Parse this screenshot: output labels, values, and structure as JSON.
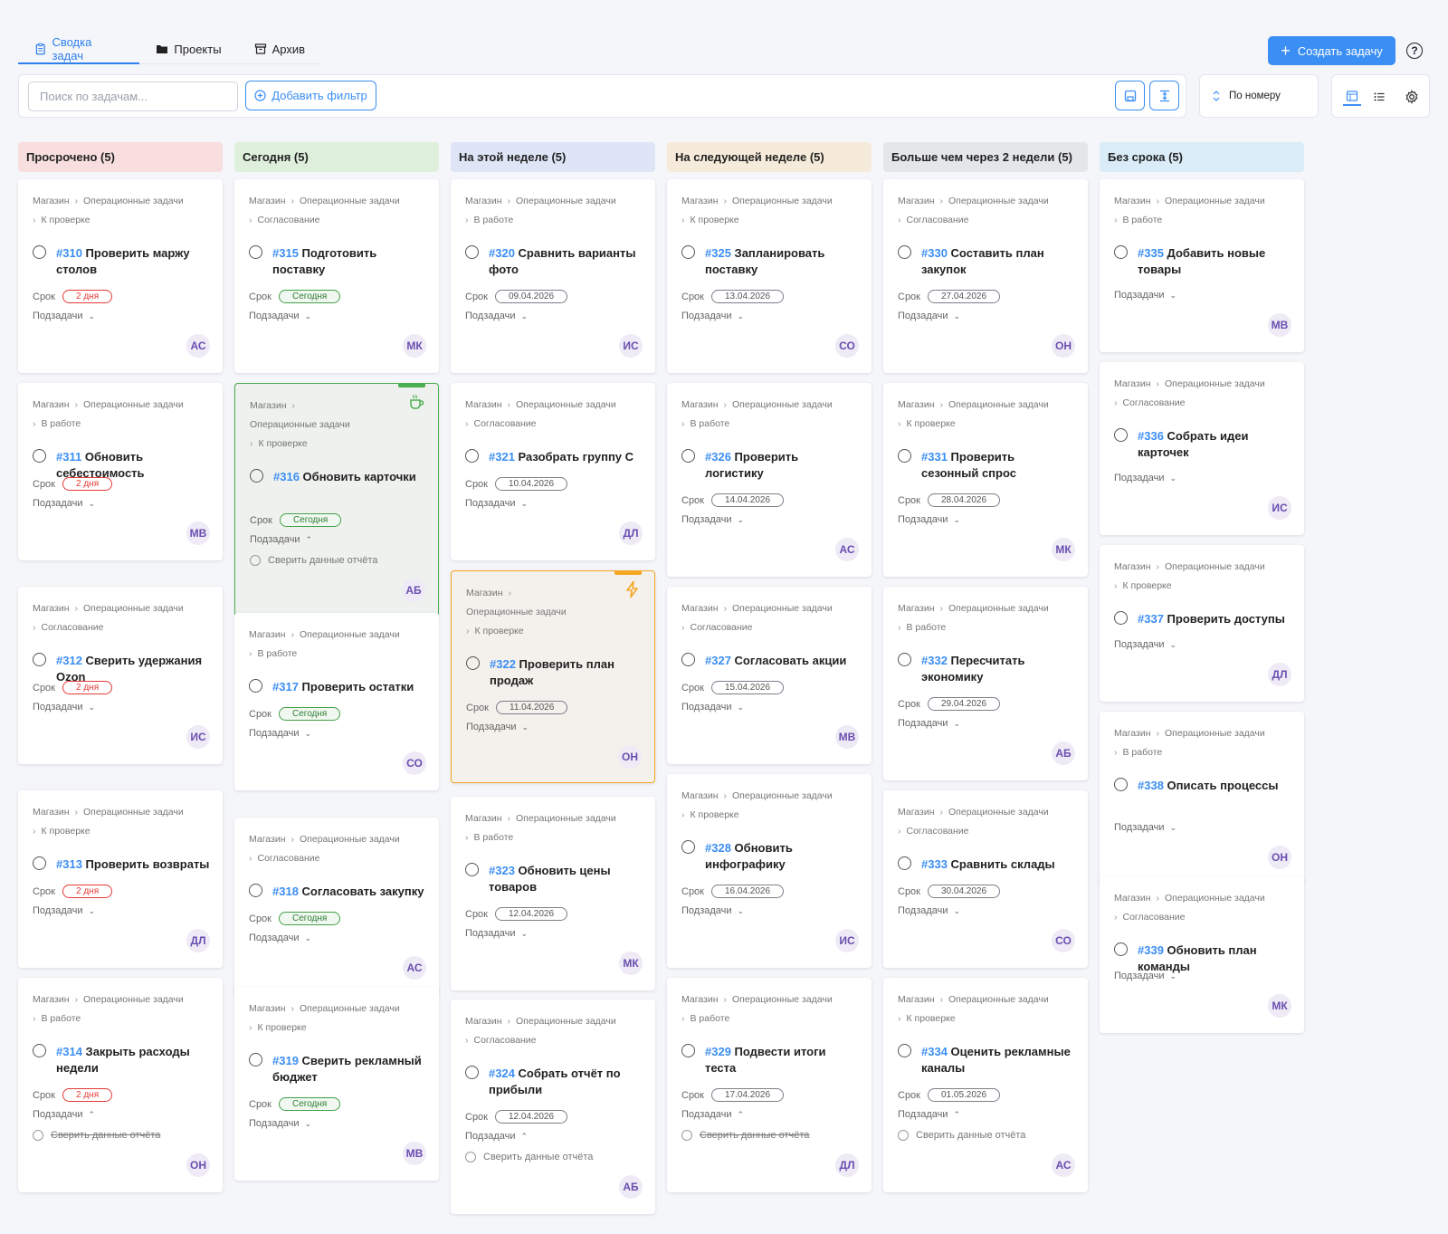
{
  "tabs": [
    {
      "label": "Сводка задач",
      "icon": "clipboard-icon",
      "active": true
    },
    {
      "label": "Проекты",
      "icon": "folder-icon",
      "active": false
    },
    {
      "label": "Архив",
      "icon": "archive-icon",
      "active": false
    }
  ],
  "toolbar": {
    "create_label": "Создать задачу",
    "help_label": "?"
  },
  "filters": {
    "search_placeholder": "Поиск по задачам...",
    "add_filter_label": "Добавить фильтр",
    "sort_label": "По номеру"
  },
  "colors": {
    "accent": "#3b8ef3",
    "overdue": "#e53935",
    "today": "#43a047",
    "avatar": "#6a4fb0"
  },
  "labels": {
    "due": "Срок",
    "subtasks": "Подзадачи"
  },
  "columns": [
    {
      "title": "Просрочено (5)",
      "bg": "#f8dede"
    },
    {
      "title": "Сегодня (5)",
      "bg": "#def0dc"
    },
    {
      "title": "На этой неделе (5)",
      "bg": "#dde5f6"
    },
    {
      "title": "На следующей неделе (5)",
      "bg": "#f6ebda"
    },
    {
      "title": "Больше чем через 2 недели (5)",
      "bg": "#e4e6ea"
    },
    {
      "title": "Без срока (5)",
      "bg": "#d9ecf8"
    }
  ],
  "cards": [
    {
      "c1": "Магазин",
      "c2": "Операционные задачи",
      "c3": "К проверке",
      "num": "#310",
      "title": "Проверить маржу столов",
      "due": "2 дня",
      "avatar": "АС"
    },
    {
      "c1": "Магазин",
      "c2": "Операционные задачи",
      "c3": "В работе",
      "num": "#311",
      "title": "Обновить себестоимость",
      "due": "2 дня",
      "avatar": "МВ"
    },
    {
      "c1": "Магазин",
      "c2": "Операционные задачи",
      "c3": "Согласование",
      "num": "#312",
      "title": "Сверить удержания Ozon",
      "due": "2 дня",
      "avatar": "ИС"
    },
    {
      "c1": "Магазин",
      "c2": "Операционные задачи",
      "c3": "К проверке",
      "num": "#313",
      "title": "Проверить возвраты",
      "due": "2 дня",
      "avatar": "ДЛ"
    },
    {
      "c1": "Магазин",
      "c2": "Операционные задачи",
      "c3": "В работе",
      "num": "#314",
      "title": "Закрыть расходы недели",
      "due": "2 дня",
      "avatar": "ОН",
      "subtask": "Сверить данные отчёта"
    },
    {
      "c1": "Магазин",
      "c2": "Операционные задачи",
      "c3": "Согласование",
      "num": "#315",
      "title": "Подготовить поставку",
      "due": "Сегодня",
      "avatar": "МК"
    },
    {
      "c1": "Магазин",
      "c2": "Операционные задачи",
      "c3": "К проверке",
      "num": "#316",
      "title": "Обновить карточки",
      "due": "Сегодня",
      "avatar": "АБ",
      "subtask": "Сверить данные отчёта",
      "icon": "coffee-icon"
    },
    {
      "c1": "Магазин",
      "c2": "Операционные задачи",
      "c3": "В работе",
      "num": "#317",
      "title": "Проверить остатки",
      "due": "Сегодня",
      "avatar": "СО"
    },
    {
      "c1": "Магазин",
      "c2": "Операционные задачи",
      "c3": "Согласование",
      "num": "#318",
      "title": "Согласовать закупку",
      "due": "Сегодня",
      "avatar": "АС"
    },
    {
      "c1": "Магазин",
      "c2": "Операционные задачи",
      "c3": "К проверке",
      "num": "#319",
      "title": "Сверить рекламный бюджет",
      "due": "Сегодня",
      "avatar": "МВ"
    },
    {
      "c1": "Магазин",
      "c2": "Операционные задачи",
      "c3": "В работе",
      "num": "#320",
      "title": "Сравнить варианты фото",
      "due": "09.04.2026",
      "avatar": "ИС"
    },
    {
      "c1": "Магазин",
      "c2": "Операционные задачи",
      "c3": "Согласование",
      "num": "#321",
      "title": "Разобрать группу С",
      "due": "10.04.2026",
      "avatar": "ДЛ"
    },
    {
      "c1": "Магазин",
      "c2": "Операционные задачи",
      "c3": "К проверке",
      "num": "#322",
      "title": "Проверить план продаж",
      "due": "11.04.2026",
      "avatar": "ОН",
      "icon": "lightning-icon"
    },
    {
      "c1": "Магазин",
      "c2": "Операционные задачи",
      "c3": "В работе",
      "num": "#323",
      "title": "Обновить цены товаров",
      "due": "12.04.2026",
      "avatar": "МК"
    },
    {
      "c1": "Магазин",
      "c2": "Операционные задачи",
      "c3": "Согласование",
      "num": "#324",
      "title": "Собрать отчёт по прибыли",
      "due": "12.04.2026",
      "avatar": "АБ",
      "subtask": "Сверить данные отчёта"
    },
    {
      "c1": "Магазин",
      "c2": "Операционные задачи",
      "c3": "К проверке",
      "num": "#325",
      "title": "Запланировать поставку",
      "due": "13.04.2026",
      "avatar": "СО"
    },
    {
      "c1": "Магазин",
      "c2": "Операционные задачи",
      "c3": "В работе",
      "num": "#326",
      "title": "Проверить логистику",
      "due": "14.04.2026",
      "avatar": "АС"
    },
    {
      "c1": "Магазин",
      "c2": "Операционные задачи",
      "c3": "Согласование",
      "num": "#327",
      "title": "Согласовать акции",
      "due": "15.04.2026",
      "avatar": "МВ"
    },
    {
      "c1": "Магазин",
      "c2": "Операционные задачи",
      "c3": "К проверке",
      "num": "#328",
      "title": "Обновить инфографику",
      "due": "16.04.2026",
      "avatar": "ИС"
    },
    {
      "c1": "Магазин",
      "c2": "Операционные задачи",
      "c3": "В работе",
      "num": "#329",
      "title": "Подвести итоги теста",
      "due": "17.04.2026",
      "avatar": "ДЛ",
      "subtask": "Сверить данные отчёта"
    },
    {
      "c1": "Магазин",
      "c2": "Операционные задачи",
      "c3": "Согласование",
      "num": "#330",
      "title": "Составить план закупок",
      "due": "27.04.2026",
      "avatar": "ОН"
    },
    {
      "c1": "Магазин",
      "c2": "Операционные задачи",
      "c3": "К проверке",
      "num": "#331",
      "title": "Проверить сезонный спрос",
      "due": "28.04.2026",
      "avatar": "МК"
    },
    {
      "c1": "Магазин",
      "c2": "Операционные задачи",
      "c3": "В работе",
      "num": "#332",
      "title": "Пересчитать экономику",
      "due": "29.04.2026",
      "avatar": "АБ"
    },
    {
      "c1": "Магазин",
      "c2": "Операционные задачи",
      "c3": "Согласование",
      "num": "#333",
      "title": "Сравнить склады",
      "due": "30.04.2026",
      "avatar": "СО"
    },
    {
      "c1": "Магазин",
      "c2": "Операционные задачи",
      "c3": "К проверке",
      "num": "#334",
      "title": "Оценить рекламные каналы",
      "due": "01.05.2026",
      "avatar": "АС",
      "subtask": "Сверить данные отчёта"
    },
    {
      "c1": "Магазин",
      "c2": "Операционные задачи",
      "c3": "В работе",
      "num": "#335",
      "title": "Добавить новые товары",
      "avatar": "МВ"
    },
    {
      "c1": "Магазин",
      "c2": "Операционные задачи",
      "c3": "Согласование",
      "num": "#336",
      "title": "Собрать идеи карточек",
      "avatar": "ИС"
    },
    {
      "c1": "Магазин",
      "c2": "Операционные задачи",
      "c3": "К проверке",
      "num": "#337",
      "title": "Проверить доступы",
      "avatar": "ДЛ"
    },
    {
      "c1": "Магазин",
      "c2": "Операционные задачи",
      "c3": "В работе",
      "num": "#338",
      "title": "Описать процессы",
      "avatar": "ОН"
    },
    {
      "c1": "Магазин",
      "c2": "Операционные задачи",
      "c3": "Согласование",
      "num": "#339",
      "title": "Обновить план команды",
      "avatar": "МК"
    }
  ]
}
